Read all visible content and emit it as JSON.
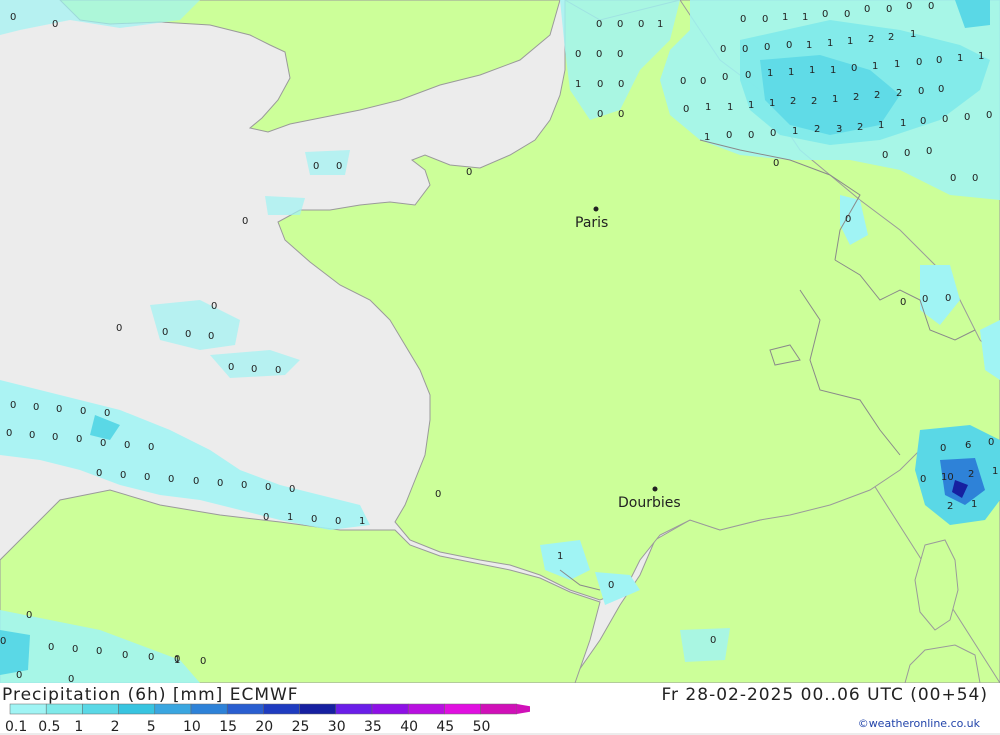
{
  "map": {
    "cities": [
      {
        "name": "Paris"
      },
      {
        "name": "Dourbies"
      }
    ],
    "precip_labels": {
      "england": [
        "0",
        "0",
        "0",
        "0",
        "0",
        "1",
        "0",
        "0",
        "0",
        "1",
        "0",
        "0",
        "0",
        "0",
        "0",
        "0",
        "0",
        "0",
        "0",
        "0"
      ],
      "benelux": [
        "0",
        "0",
        "1",
        "1",
        "0",
        "0",
        "0",
        "0",
        "0",
        "0",
        "0",
        "0",
        "0",
        "0",
        "1",
        "1",
        "1",
        "2",
        "2",
        "1",
        "0",
        "0",
        "0",
        "1",
        "1",
        "1",
        "1",
        "0",
        "1",
        "1",
        "0",
        "0",
        "1",
        "1",
        "0",
        "1",
        "1",
        "1",
        "1",
        "2",
        "2",
        "1",
        "2",
        "2",
        "2",
        "0",
        "0",
        "1",
        "0",
        "0",
        "0",
        "1",
        "2",
        "3",
        "2",
        "1",
        "1",
        "0",
        "0",
        "0",
        "0",
        "0",
        "0",
        "0",
        "0"
      ],
      "channel": [
        "0",
        "0",
        "0",
        "0",
        "0"
      ],
      "atlantic": [
        "0",
        "0",
        "0",
        "0",
        "0",
        "0",
        "0",
        "0",
        "0",
        "0",
        "0",
        "0",
        "0",
        "0",
        "0",
        "0",
        "0",
        "0",
        "0",
        "0",
        "0",
        "0",
        "0",
        "0",
        "0",
        "0",
        "0",
        "0",
        "0",
        "0",
        "1",
        "0",
        "0",
        "1",
        "0",
        "0",
        "0",
        "0",
        "0",
        "0",
        "0",
        "0",
        "0",
        "0"
      ],
      "south": [
        "0",
        "1",
        "0",
        "0",
        "0",
        "1",
        "0",
        "0",
        "1",
        "0",
        "0",
        "0",
        "2",
        "1",
        "1"
      ],
      "alps_ligurian": [
        "0",
        "1",
        "0",
        "0",
        "6",
        "0",
        "0",
        "10",
        "2",
        "1",
        "2",
        "1"
      ]
    }
  },
  "footer": {
    "title": "Precipitation (6h) [mm] ECMWF",
    "date": "Fr 28-02-2025 00..06 UTC (00+54)",
    "credit": "©weatheronline.co.uk",
    "legend": {
      "labels": [
        "0.1",
        "0.5",
        "1",
        "2",
        "5",
        "10",
        "15",
        "20",
        "25",
        "30",
        "35",
        "40",
        "45",
        "50"
      ],
      "colors": [
        "#a0f4f4",
        "#80eaea",
        "#5ad8e6",
        "#38c4e0",
        "#3aa6e0",
        "#2e82d8",
        "#2a5ed0",
        "#1f3cc0",
        "#1620a0",
        "#6a1ee8",
        "#8e10e6",
        "#b810e0",
        "#e010e0",
        "#d010b8"
      ]
    }
  }
}
